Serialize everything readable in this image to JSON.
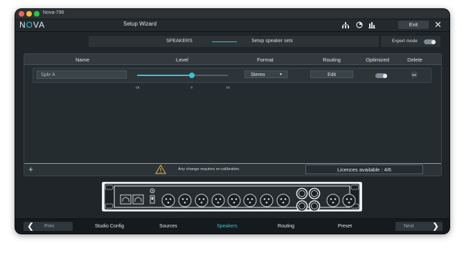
{
  "window": {
    "title": "Nova-796"
  },
  "header": {
    "logo_left": "N",
    "logo_accent": "O",
    "logo_right": "VA",
    "title": "Setup Wizard",
    "icons": [
      "network-icon",
      "calibration-icon",
      "levels-icon"
    ],
    "exit_label": "Exit",
    "close_icon": "close-icon"
  },
  "steps": {
    "current": "SPEAKERS",
    "description": "Setup speaker sets",
    "expert_label": "Expert mode",
    "expert_enabled": true
  },
  "table": {
    "columns": [
      "Name",
      "Level",
      "Format",
      "Routing",
      "Optimized",
      "Delete"
    ],
    "rows": [
      {
        "name": "Spkr A",
        "level": {
          "min": "-15",
          "mid": "0",
          "max": "10",
          "value": 0
        },
        "format": "Stereo",
        "routing": "Edit",
        "optimized": true
      }
    ]
  },
  "footer": {
    "add_icon": "plus-icon",
    "warning_icon": "warning-icon",
    "warning": "Any change requires re-calibration.",
    "licences": "Licences available : 4/6"
  },
  "nav": {
    "prev": "Prev",
    "next": "Next",
    "items": [
      "Studio Config",
      "Sources",
      "Speakers",
      "Routing",
      "Preset"
    ],
    "active": "Speakers"
  },
  "colors": {
    "accent": "#36c4d8",
    "background": "#1f2528",
    "panel": "#252c30"
  }
}
